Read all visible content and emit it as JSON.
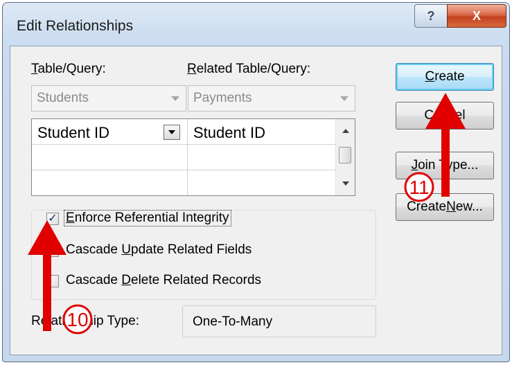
{
  "window": {
    "title": "Edit Relationships",
    "help_glyph": "?",
    "close_glyph": "X"
  },
  "table": {
    "label_prefix": "T",
    "label_rest": "able/Query:",
    "value": "Students"
  },
  "related": {
    "label_prefix": "R",
    "label_rest": "elated Table/Query:",
    "value": "Payments"
  },
  "grid": {
    "rows": [
      {
        "left": "Student ID",
        "right": "Student ID"
      },
      {
        "left": "",
        "right": ""
      },
      {
        "left": "",
        "right": ""
      }
    ]
  },
  "options": {
    "enforce": {
      "prefix": "E",
      "rest": "nforce Referential Integrity",
      "checked": true,
      "check_glyph": "✓"
    },
    "cascade_update": {
      "pre": "Cascade ",
      "key": "U",
      "rest": "pdate Related Fields",
      "checked": false
    },
    "cascade_delete": {
      "pre": "Cascade ",
      "key": "D",
      "rest": "elete Related Records",
      "checked": false
    }
  },
  "buttons": {
    "create": {
      "key": "C",
      "rest": "reate"
    },
    "cancel": {
      "label": "Cancel"
    },
    "join": {
      "key": "J",
      "rest": "oin Type..."
    },
    "create_new": {
      "pre": "Create ",
      "key": "N",
      "rest": "ew..."
    }
  },
  "relationship_type": {
    "label": "Relationship Type:",
    "value": "One-To-Many"
  },
  "annotations": [
    {
      "number": "10",
      "color": "#e00000"
    },
    {
      "number": "11",
      "color": "#e00000"
    }
  ]
}
